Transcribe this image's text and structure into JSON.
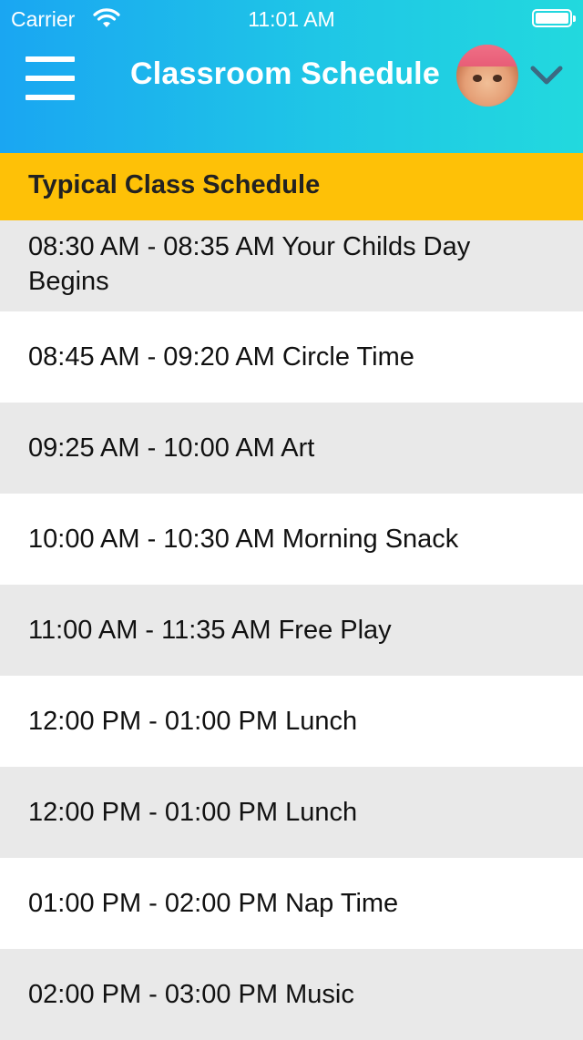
{
  "status_bar": {
    "carrier": "Carrier",
    "time": "11:01 AM",
    "icons": [
      "wifi-icon",
      "battery-icon"
    ]
  },
  "nav": {
    "title": "Classroom Schedule",
    "menu_icon": "hamburger-menu-icon",
    "dropdown_icon": "chevron-down-icon",
    "avatar": "child-avatar",
    "colors": {
      "gradient_start": "#1aa6f2",
      "gradient_end": "#22d9de"
    }
  },
  "section": {
    "title": "Typical Class Schedule",
    "color": "#fec107"
  },
  "schedule": [
    {
      "text": "08:30 AM - 08:35 AM Your Childs Day Begins"
    },
    {
      "text": "08:45 AM - 09:20 AM Circle Time"
    },
    {
      "text": "09:25 AM - 10:00 AM Art"
    },
    {
      "text": "10:00 AM - 10:30 AM Morning Snack"
    },
    {
      "text": "11:00 AM - 11:35 AM Free Play"
    },
    {
      "text": "12:00 PM - 01:00 PM Lunch"
    },
    {
      "text": "12:00 PM - 01:00 PM Lunch"
    },
    {
      "text": "01:00 PM - 02:00 PM Nap Time"
    },
    {
      "text": "02:00 PM - 03:00 PM Music"
    }
  ]
}
